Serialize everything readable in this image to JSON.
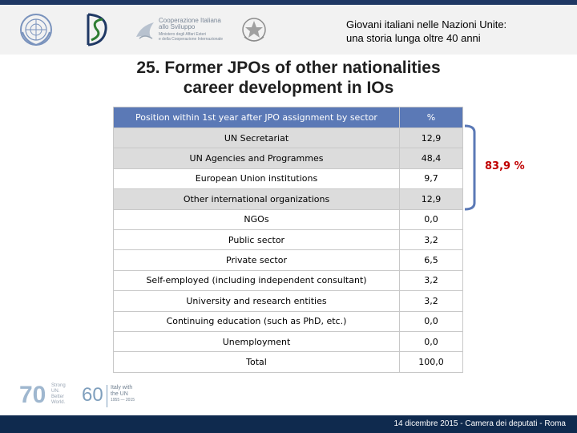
{
  "header": {
    "event_title_line1": "Giovani italiani nelle Nazioni Unite:",
    "event_title_line2": "una storia lunga oltre 40 anni",
    "coop_logo_text_line1": "Cooperazione Italiana",
    "coop_logo_text_line2": "allo Sviluppo",
    "coop_logo_text_line3": "Ministero degli Affari Esteri",
    "coop_logo_text_line4": "e della Cooperazione Internazionale"
  },
  "slide": {
    "title_line1": "25. Former JPOs of other nationalities",
    "title_line2": "career development in IOs"
  },
  "table": {
    "header_sector": "Position within 1st year after JPO assignment by sector",
    "header_percent": "%",
    "rows": [
      {
        "sector": "UN Secretariat",
        "percent": "12,9"
      },
      {
        "sector": "UN Agencies and Programmes",
        "percent": "48,4"
      },
      {
        "sector": "European Union institutions",
        "percent": "9,7"
      },
      {
        "sector": "Other international organizations",
        "percent": "12,9"
      },
      {
        "sector": "NGOs",
        "percent": "0,0"
      },
      {
        "sector": "Public sector",
        "percent": "3,2"
      },
      {
        "sector": "Private sector",
        "percent": "6,5"
      },
      {
        "sector": "Self-employed (including independent consultant)",
        "percent": "3,2"
      },
      {
        "sector": "University and research entities",
        "percent": "3,2"
      },
      {
        "sector": "Continuing education (such as PhD, etc.)",
        "percent": "0,0"
      },
      {
        "sector": "Unemployment",
        "percent": "0,0"
      },
      {
        "sector": "Total",
        "percent": "100,0"
      }
    ]
  },
  "bracket": {
    "value": "83,9 %",
    "color": "#c00000"
  },
  "footer": {
    "logo70_text": "70",
    "logo70_tagline_1": "Strong",
    "logo70_tagline_2": "UN.",
    "logo70_tagline_3": "Better",
    "logo70_tagline_4": "World.",
    "logo60_text": "60",
    "logo60_caption_1": "Italy with",
    "logo60_caption_2": "the UN",
    "logo60_years": "1955 — 2015",
    "bottom_text": "14 dicembre 2015 - Camera dei deputati - Roma"
  },
  "colors": {
    "top_stripe": "#1f3864",
    "table_header": "#5b79b6",
    "shaded_row": "#dcdcdc",
    "bottom_bar": "#0f2a4e",
    "bracket": "#5b79b6"
  },
  "icons": [
    "un-emblem-icon",
    "ds-monogram-icon",
    "dove-icon",
    "italian-emblem-icon",
    "un70-logo-icon",
    "italy-un60-logo-icon"
  ]
}
